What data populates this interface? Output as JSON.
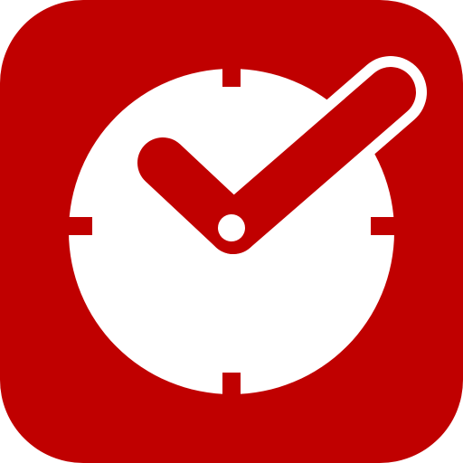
{
  "icon": {
    "name": "clock-checkmark-app-icon",
    "colors": {
      "background": "#c00000",
      "foreground": "#ffffff",
      "page": "#ffffff"
    }
  }
}
